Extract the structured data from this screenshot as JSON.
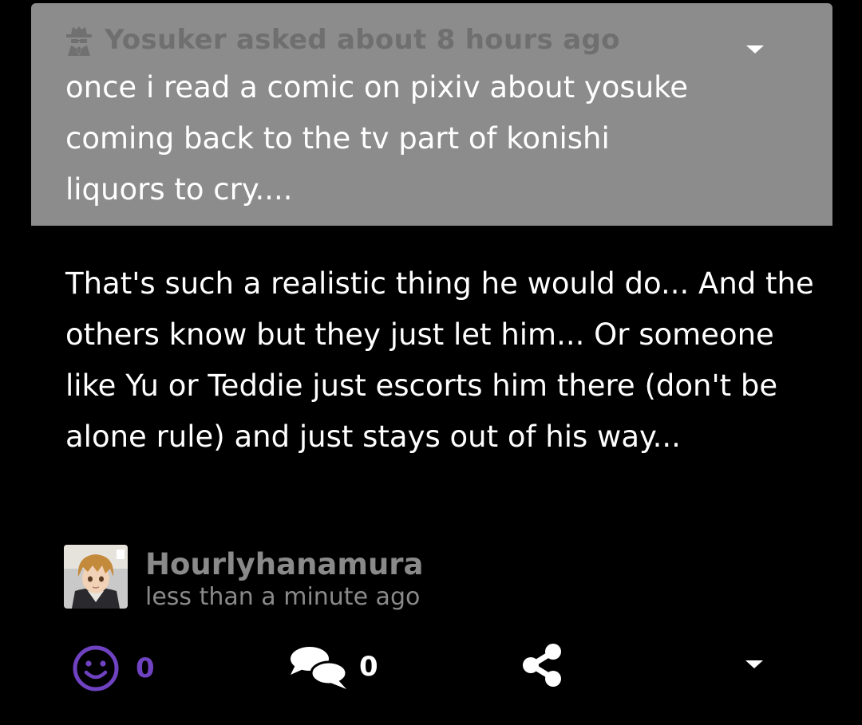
{
  "question": {
    "asker": "Yosuker asked about 8 hours ago",
    "text": "once i read a comic on pixiv about yosuke coming back to the tv part of konishi liquors to cry....",
    "anon_icon": "spy-icon",
    "menu_icon": "caret-down-icon"
  },
  "answer": {
    "text": "That's such a realistic thing he would do... And the others know but they just let him... Or someone like Yu or Teddie just escorts him there (don't be alone rule) and just stays out of his way..."
  },
  "author": {
    "name": "Hourlyhanamura",
    "time": "less than a minute ago"
  },
  "actions": {
    "react_count": "0",
    "comment_count": "0",
    "react_icon": "smiley-icon",
    "comment_icon": "speech-bubbles-icon",
    "share_icon": "share-icon",
    "more_icon": "caret-down-icon"
  },
  "colors": {
    "background": "#000000",
    "question_card": "#8c8c8c",
    "accent": "#6f42c1",
    "muted_text": "#8a8a8a"
  }
}
